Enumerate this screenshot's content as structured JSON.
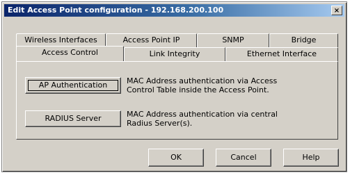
{
  "window": {
    "title": "Edit Access Point configuration - 192.168.200.100",
    "close_glyph": "×"
  },
  "tabs_row_back": [
    "Wireless Interfaces",
    "Access Point IP",
    "SNMP",
    "Bridge"
  ],
  "tabs_row_front": [
    "Access Control",
    "Link Integrity",
    "Ethernet Interface"
  ],
  "active_tab": "Access Control",
  "panel": {
    "ap_auth_button": "AP Authentication",
    "ap_auth_desc": "MAC Address authentication via Access Control Table inside the Access Point.",
    "radius_button": "RADIUS Server",
    "radius_desc": "MAC Address authentication via central Radius Server(s)."
  },
  "footer": {
    "ok": "OK",
    "cancel": "Cancel",
    "help": "Help"
  }
}
